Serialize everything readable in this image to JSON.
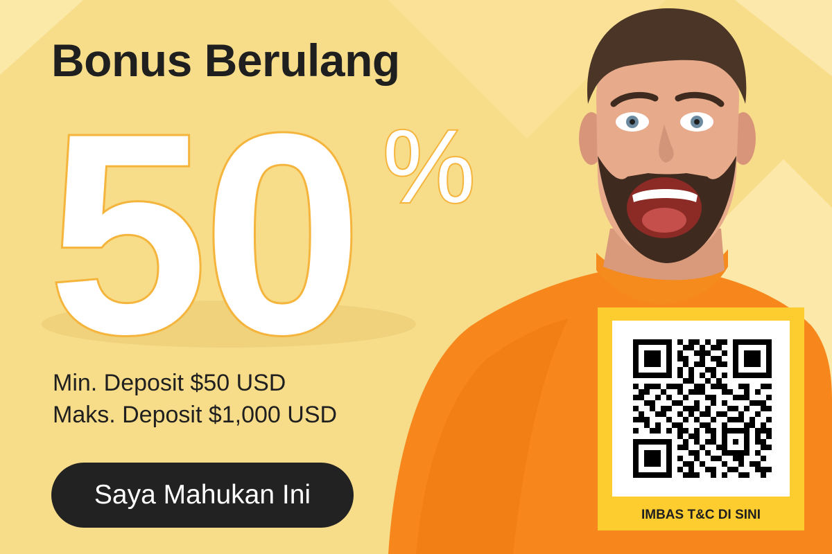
{
  "banner": {
    "title": "Bonus Berulang",
    "bonus_number": "50",
    "bonus_symbol": "%",
    "min_deposit": "Min. Deposit $50 USD",
    "max_deposit": "Maks. Deposit $1,000 USD",
    "cta_label": "Saya Mahukan Ini"
  },
  "qr": {
    "caption": "IMBAS T&C DI SINI"
  },
  "colors": {
    "background": "#f7dd8a",
    "accent_yellow": "#fdcd2f",
    "sweater_orange": "#f7871c",
    "text_dark": "#1f1f1f",
    "button_dark": "#222222"
  },
  "icons": {
    "person": "excited-man-photo",
    "qr": "qr-code-icon"
  }
}
